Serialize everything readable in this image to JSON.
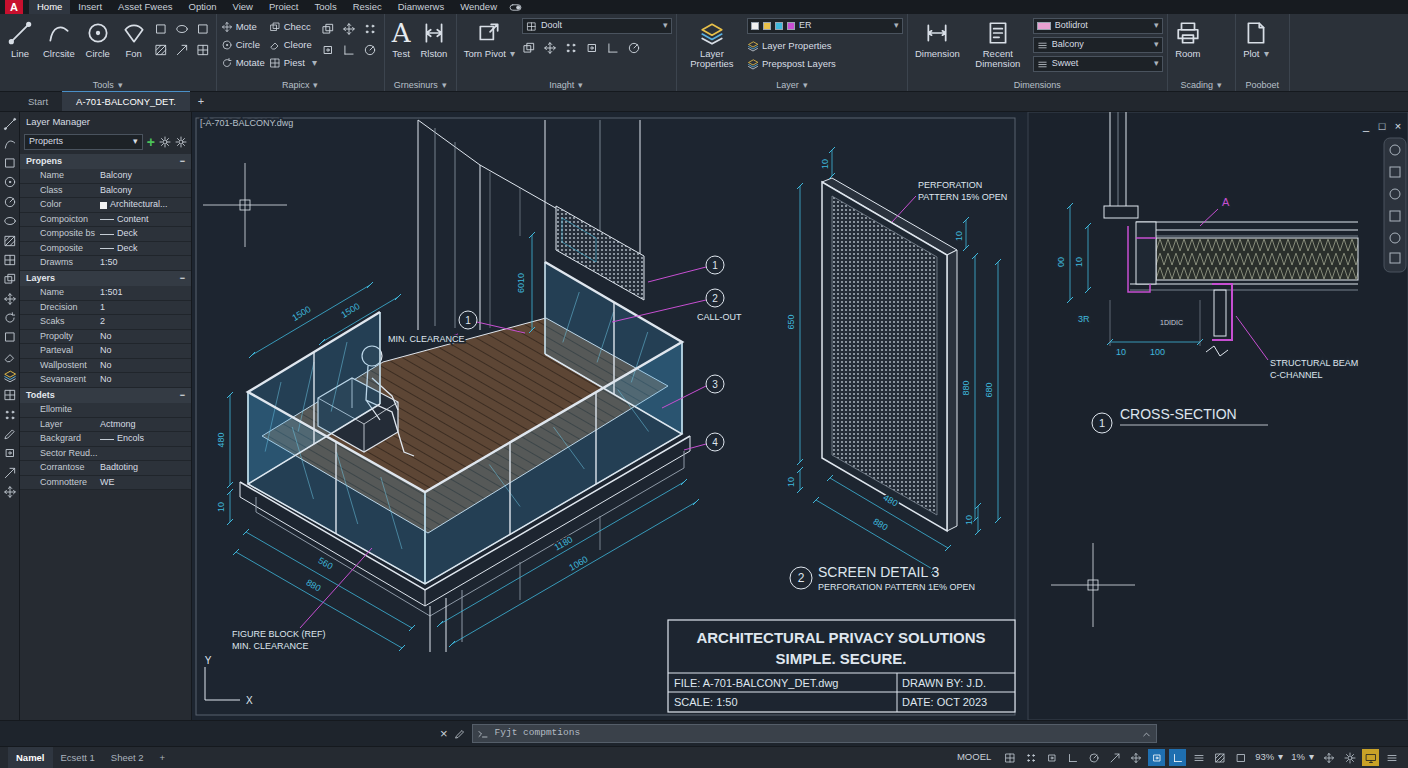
{
  "app": {
    "logo": "A"
  },
  "menu": {
    "tabs": [
      {
        "label": "Home",
        "selected": true
      },
      {
        "label": "Insert",
        "selected": false
      },
      {
        "label": "Asset Fwees",
        "selected": false
      },
      {
        "label": "Option",
        "selected": false
      },
      {
        "label": "View",
        "selected": false
      },
      {
        "label": "Proiect",
        "selected": false
      },
      {
        "label": "Tools",
        "selected": false
      },
      {
        "label": "Resiec",
        "selected": false
      },
      {
        "label": "Dianwerws",
        "selected": false
      },
      {
        "label": "Wendew",
        "selected": false
      }
    ]
  },
  "ribbon": {
    "caret": "▾",
    "groups": [
      {
        "label": "Tools",
        "menu": true,
        "columns": [
          [
            {
              "kind": "large",
              "label": "Line"
            }
          ],
          [
            {
              "kind": "large",
              "label": "Clrcsite"
            }
          ],
          [
            {
              "kind": "large",
              "label": "Circle"
            }
          ],
          [
            {
              "kind": "large",
              "label": "Fon"
            }
          ],
          [
            {
              "kind": "icongrid"
            }
          ]
        ]
      },
      {
        "label": "Rapicx",
        "menu": true,
        "columns": [
          [
            {
              "kind": "small",
              "label": "Mote"
            },
            {
              "kind": "small",
              "label": "Circle"
            },
            {
              "kind": "small",
              "label": "Motate"
            }
          ],
          [
            {
              "kind": "small",
              "label": "Checc"
            },
            {
              "kind": "small",
              "label": "Cleore"
            },
            {
              "kind": "small",
              "label": "Piest",
              "menu": true
            }
          ],
          [
            {
              "kind": "icongrid"
            }
          ]
        ]
      },
      {
        "label": "Grnesinurs",
        "menu": true,
        "columns": [
          [
            {
              "kind": "large",
              "label": "Test",
              "glyph": "A"
            }
          ],
          [
            {
              "kind": "large",
              "label": "Rlston"
            }
          ]
        ]
      },
      {
        "label": "Inaght",
        "menu": true,
        "columns": [
          [
            {
              "kind": "large",
              "label": "Torn Pivot",
              "menu": true
            }
          ],
          [
            {
              "kind": "dropdown",
              "value": "Doolt"
            },
            {
              "kind": "icongrid"
            }
          ]
        ]
      },
      {
        "label": "Layer",
        "menu": true,
        "columns": [
          [
            {
              "kind": "large",
              "label": "Layer Properties"
            }
          ],
          [
            {
              "kind": "dropdown",
              "value": "ER"
            },
            {
              "kind": "small",
              "label": "Layer Properties"
            },
            {
              "kind": "small",
              "label": "Prepspost Layers"
            }
          ]
        ]
      },
      {
        "label": "Dimensions",
        "menu": false,
        "columns": [
          [
            {
              "kind": "large",
              "label": "Dimension"
            }
          ],
          [
            {
              "kind": "large",
              "label": "Recent Dimension"
            }
          ],
          [
            {
              "kind": "dropdown",
              "value": "Botlidrot"
            },
            {
              "kind": "dropdown",
              "value": "Balcony"
            },
            {
              "kind": "dropdown",
              "value": "Swwet"
            }
          ]
        ]
      },
      {
        "label": "Scading",
        "menu": true,
        "columns": [
          [
            {
              "kind": "large",
              "label": "Room"
            }
          ]
        ]
      },
      {
        "label": "Pooboet",
        "menu": false,
        "columns": [
          [
            {
              "kind": "large",
              "label": "Plot",
              "menu": true
            }
          ]
        ]
      }
    ]
  },
  "doc_tabs": {
    "tabs": [
      {
        "label": "Start",
        "selected": false
      },
      {
        "label": "A-701-BALCONY_DET.",
        "selected": true
      }
    ],
    "add": "+"
  },
  "layer_manager": {
    "title": "Layer Manager",
    "filter": "Properts",
    "caret": "▾",
    "add": "+",
    "sections": [
      {
        "title": "Propens",
        "toggle": "−",
        "rows": [
          {
            "label": "Name",
            "value": "Balcony",
            "kind": "text"
          },
          {
            "label": "Class",
            "value": "Balcony",
            "kind": "text"
          },
          {
            "label": "Color",
            "value": "Architectural...",
            "kind": "swatch"
          },
          {
            "label": "Compoicton",
            "value": "Content",
            "kind": "line"
          },
          {
            "label": "Composite bs",
            "value": "Deck",
            "kind": "line"
          },
          {
            "label": "Composite",
            "value": "Deck",
            "kind": "line"
          },
          {
            "label": "Drawms",
            "value": "1:50",
            "kind": "text"
          }
        ]
      },
      {
        "title": "Layers",
        "toggle": "−",
        "rows": [
          {
            "label": "Name",
            "value": "1:501",
            "kind": "text"
          },
          {
            "label": "Drecision",
            "value": "1",
            "kind": "text"
          },
          {
            "label": "Scaks",
            "value": "2",
            "kind": "text"
          },
          {
            "label": "Propolty",
            "value": "No",
            "kind": "text"
          },
          {
            "label": "Parteval",
            "value": "No",
            "kind": "text"
          },
          {
            "label": "Wallpostent",
            "value": "No",
            "kind": "text"
          },
          {
            "label": "Sevanarent",
            "value": "No",
            "kind": "text"
          }
        ]
      },
      {
        "title": "Todets",
        "toggle": "−",
        "rows": [
          {
            "label": "Ellomite",
            "value": "",
            "kind": "text"
          },
          {
            "label": "Layer",
            "value": "Actmong",
            "kind": "text"
          },
          {
            "label": "Backgrard",
            "value": "Encols",
            "kind": "line"
          },
          {
            "label": "Sector Reud...",
            "value": "",
            "kind": "text"
          },
          {
            "label": "Corrantose",
            "value": "Badtoting",
            "kind": "text"
          },
          {
            "label": "Comnottere",
            "value": "WE",
            "kind": "text"
          }
        ]
      }
    ]
  },
  "canvas": {
    "file_label": "[-A-701-BALCONY.dwg",
    "axis": {
      "y": "Y",
      "x": "X"
    },
    "iso_dims": [
      "1500",
      "1500",
      "6010",
      "480",
      "10",
      "560",
      "880",
      "1180",
      "1060"
    ],
    "iso_labels": [
      "MIN. CLEARANCE",
      "CALL-OUT",
      "FIGURE BLOCK (REF)",
      "MIN. CLEARANCE"
    ],
    "callouts": [
      "1",
      "2",
      "3",
      "4",
      "1"
    ],
    "screen_detail": {
      "note": [
        "PERFORATION",
        "PATTERN 15% OPEN"
      ],
      "dims": [
        "10",
        "10",
        "650",
        "880",
        "680",
        "10",
        "480",
        "880",
        "10"
      ],
      "number": "2",
      "title": "SCREEN DETAIL 3",
      "subtitle": "PERFORATION PATTERN 1E% OPEN"
    },
    "title_block": {
      "title": "ARCHITECTURAL PRIVACY SOLUTIONS",
      "subtitle": "SIMPLE. SECURE.",
      "file": "FILE: A-701-BALCONY_DET.dwg",
      "drawn_by": "DRAWN BY: J.D.",
      "scale": "SCALE: 1:50",
      "date": "DATE: OCT 2023"
    }
  },
  "viewport": {
    "controls": [
      "_",
      "□",
      "×"
    ],
    "section": {
      "marker": "A",
      "dims": [
        "00",
        "10",
        "3R",
        "10",
        "100",
        "1DIDIC"
      ],
      "note": [
        "STRUCTURAL BEAM",
        "C-CHANNEL"
      ],
      "number": "1",
      "title": "CROSS-SECTION"
    }
  },
  "command_line": {
    "close": "×",
    "placeholder": "Fyjt compmtions"
  },
  "status_bar": {
    "layouts": [
      {
        "label": "Namel",
        "selected": true
      },
      {
        "label": "Ecsett 1",
        "selected": false
      },
      {
        "label": "Sheet 2",
        "selected": false
      }
    ],
    "add": "+",
    "model": "MOOEL",
    "toggles": [
      {
        "on": false
      },
      {
        "on": false
      },
      {
        "on": false
      },
      {
        "on": false
      },
      {
        "on": false
      },
      {
        "on": false
      },
      {
        "on": false
      },
      {
        "on": true
      },
      {
        "on": true
      },
      {
        "on": false
      },
      {
        "on": false
      },
      {
        "on": false
      }
    ],
    "zoom": "93%",
    "annot_scale": "1%",
    "caret": "▾",
    "tools": [
      {
        "on": false
      },
      {
        "on": false
      },
      {
        "on": true
      },
      {
        "on": false
      }
    ]
  }
}
